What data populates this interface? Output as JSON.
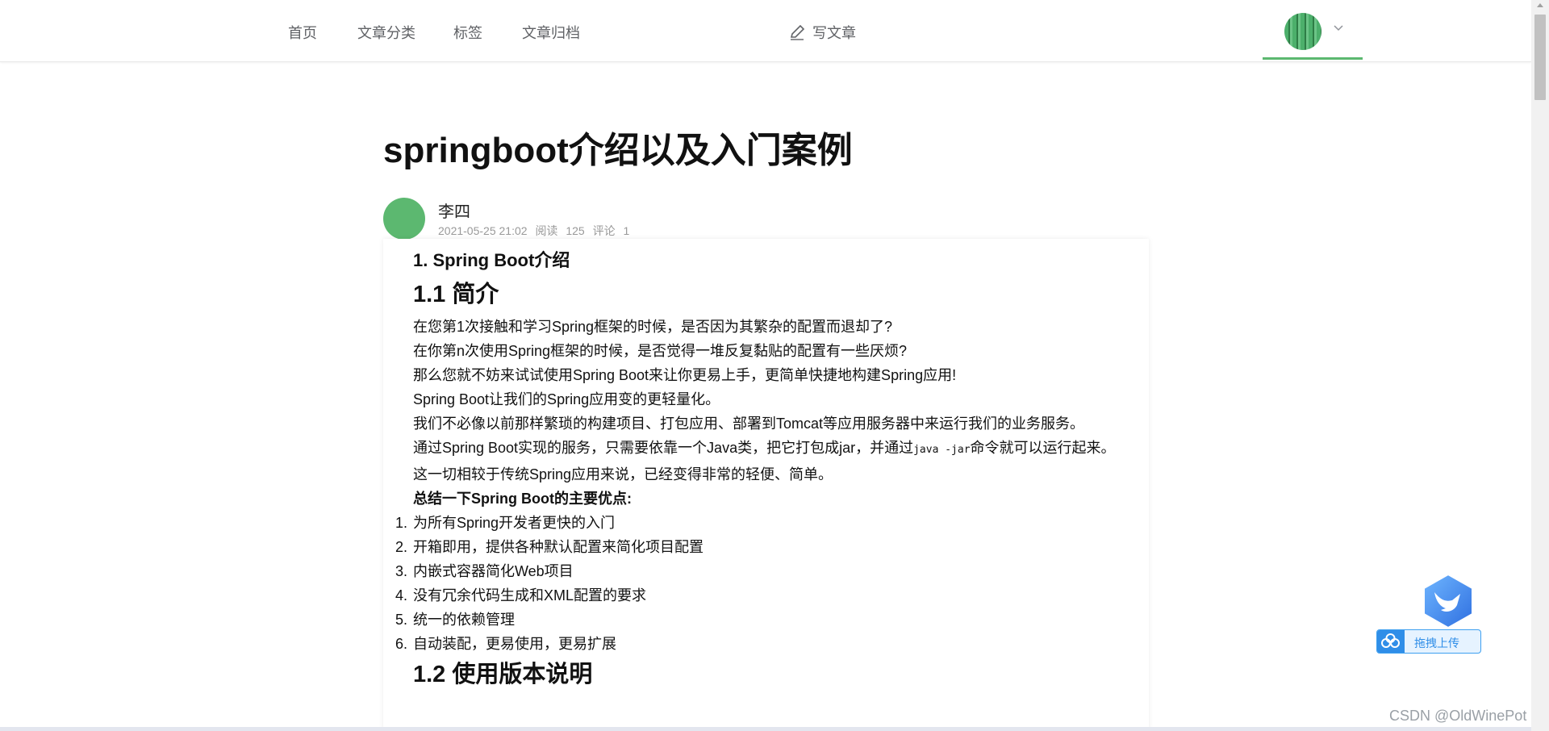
{
  "nav": {
    "items": [
      {
        "label": "首页"
      },
      {
        "label": "文章分类"
      },
      {
        "label": "标签"
      },
      {
        "label": "文章归档"
      }
    ],
    "write_label": "写文章"
  },
  "article": {
    "title": "springboot介绍以及入门案例",
    "author": "李四",
    "date": "2021-05-25 21:02",
    "read_label": "阅读",
    "read_count": "125",
    "comment_label": "评论",
    "comment_count": "1",
    "section1_title": "1. Spring Boot介绍",
    "sub1_title": "1.1 简介",
    "paragraphs": [
      "在您第1次接触和学习Spring框架的时候，是否因为其繁杂的配置而退却了?",
      "在你第n次使用Spring框架的时候，是否觉得一堆反复黏贴的配置有一些厌烦?",
      "那么您就不妨来试试使用Spring Boot来让你更易上手，更简单快捷地构建Spring应用!",
      "Spring Boot让我们的Spring应用变的更轻量化。",
      "我们不必像以前那样繁琐的构建项目、打包应用、部署到Tomcat等应用服务器中来运行我们的业务服务。"
    ],
    "p6_before": "通过Spring Boot实现的服务，只需要依靠一个Java类，把它打包成jar，并通过",
    "p6_code": "java -jar",
    "p6_after": "命令就可以运行起来。",
    "p7": "这一切相较于传统Spring应用来说，已经变得非常的轻便、简单。",
    "summary": "总结一下Spring Boot的主要优点:",
    "list": [
      {
        "num": "1.",
        "text": "为所有Spring开发者更快的入门"
      },
      {
        "num": "2.",
        "text": "开箱即用，提供各种默认配置来简化项目配置"
      },
      {
        "num": "3.",
        "text": "内嵌式容器简化Web项目"
      },
      {
        "num": "4.",
        "text": "没有冗余代码生成和XML配置的要求"
      },
      {
        "num": "5.",
        "text": "统一的依赖管理"
      },
      {
        "num": "6.",
        "text": "自动装配，更易使用，更易扩展"
      }
    ],
    "sub2_title": "1.2 使用版本说明"
  },
  "upload": {
    "label": "拖拽上传"
  },
  "watermark": "CSDN @OldWinePot",
  "colors": {
    "accent": "#5cb870",
    "upload": "#2f8ee8"
  }
}
